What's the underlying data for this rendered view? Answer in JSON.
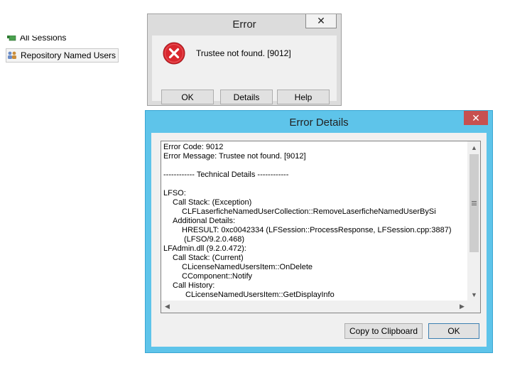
{
  "tree": {
    "items": [
      {
        "label": "All Sessions",
        "icon": "sessions-icon"
      },
      {
        "label": "Repository Named Users",
        "icon": "named-users-icon"
      }
    ]
  },
  "error_dialog": {
    "title": "Error",
    "close_glyph": "✕",
    "message": "Trustee not found. [9012]",
    "buttons": {
      "ok": "OK",
      "details": "Details",
      "help": "Help"
    }
  },
  "details_dialog": {
    "title": "Error Details",
    "close_glyph": "✕",
    "lines": [
      {
        "text": "Error Code: 9012",
        "indent": 0
      },
      {
        "text": "Error Message: Trustee not found. [9012]",
        "indent": 0
      },
      {
        "text": "",
        "indent": 0
      },
      {
        "text": "------------ Technical Details ------------",
        "indent": 0
      },
      {
        "text": "",
        "indent": 0
      },
      {
        "text": "LFSO:",
        "indent": 0
      },
      {
        "text": "Call Stack: (Exception)",
        "indent": 1
      },
      {
        "text": "CLFLaserficheNamedUserCollection::RemoveLaserficheNamedUserBySi",
        "indent": 2
      },
      {
        "text": "Additional Details:",
        "indent": 1
      },
      {
        "text": "HRESULT: 0xc0042334 (LFSession::ProcessResponse, LFSession.cpp:3887)",
        "indent": 2
      },
      {
        "text": "(LFSO/9.2.0.468)",
        "indent": 3
      },
      {
        "text": "LFAdmin.dll (9.2.0.472):",
        "indent": 0
      },
      {
        "text": "Call Stack: (Current)",
        "indent": 1
      },
      {
        "text": "CLicenseNamedUsersItem::OnDelete",
        "indent": 2
      },
      {
        "text": "CComponent::Notify",
        "indent": 2
      },
      {
        "text": "Call History:",
        "indent": 1
      },
      {
        "text": "CLicenseNamedUsersItem::GetDisplayInfo",
        "indent": 4
      }
    ],
    "buttons": {
      "copy": "Copy to Clipboard",
      "ok": "OK"
    }
  },
  "colors": {
    "accent_title": "#5ec4ea",
    "close_red": "#c75050",
    "error_icon_red": "#d9272e"
  }
}
